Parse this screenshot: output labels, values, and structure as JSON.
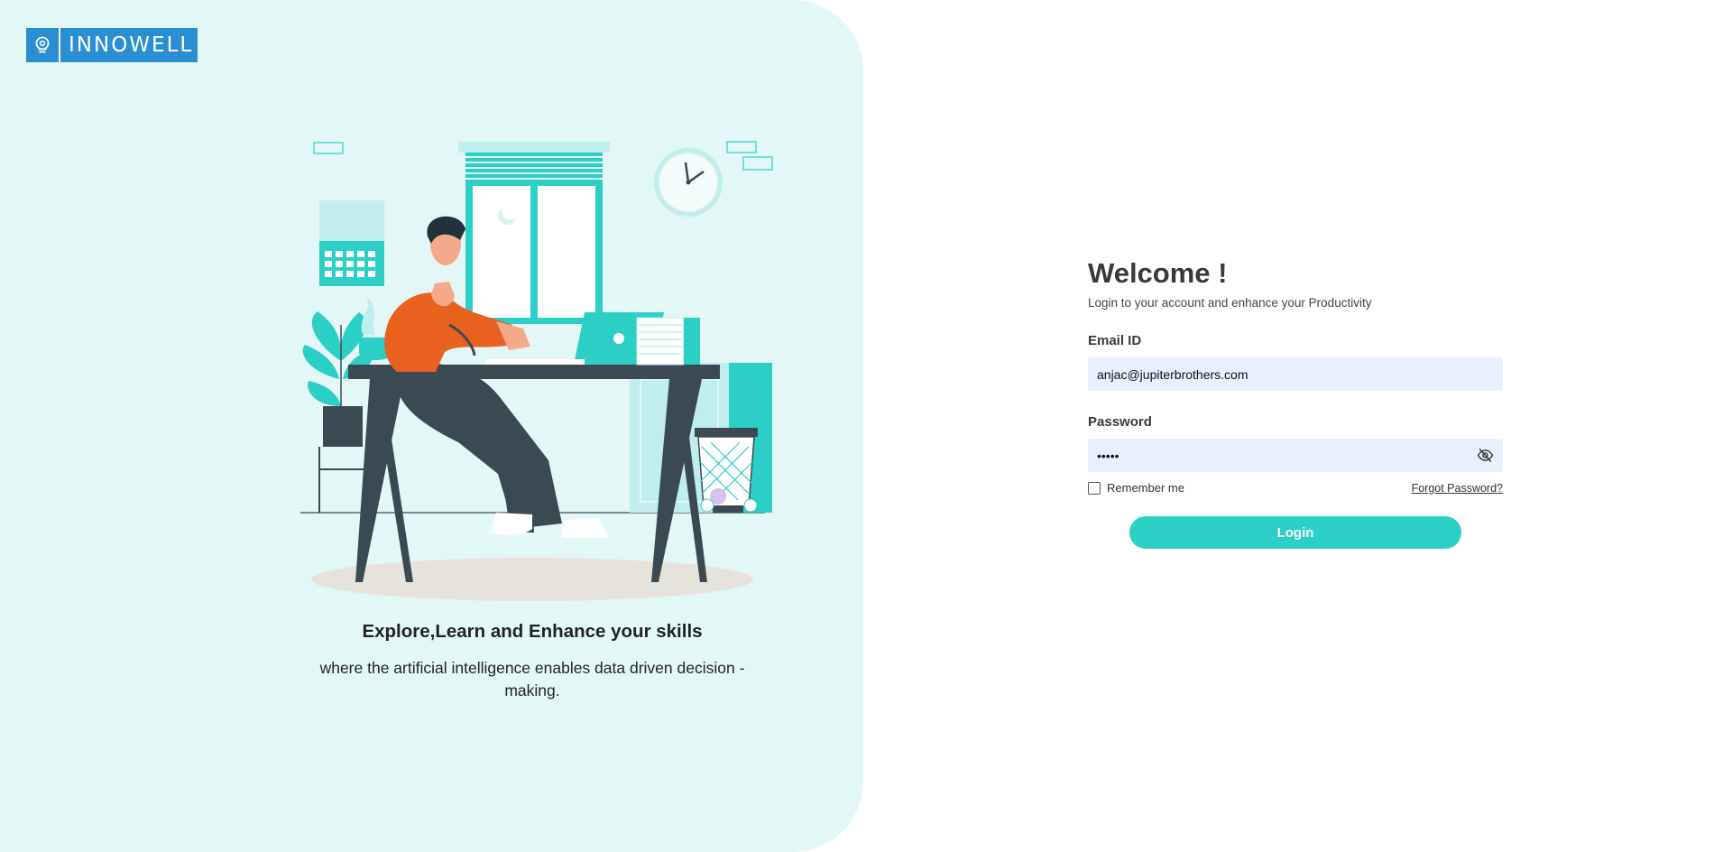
{
  "brand": {
    "name": "INNOWELL",
    "color": "#2a8ed3",
    "logo_icon": "brain-bulb-icon"
  },
  "left": {
    "tagline": "Explore,Learn and Enhance your skills",
    "subline": "where the artificial intelligence enables data driven decision - making."
  },
  "form": {
    "title": "Welcome !",
    "subtitle": "Login to your account and enhance your Productivity",
    "email_label": "Email ID",
    "email_value": "anjac@jupiterbrothers.com",
    "password_label": "Password",
    "password_value": "•••••",
    "remember_label": "Remember me",
    "forgot_label": "Forgot Password?",
    "login_label": "Login",
    "accent_color": "#2ccfc5",
    "password_toggle_icon": "eye-off-icon"
  }
}
